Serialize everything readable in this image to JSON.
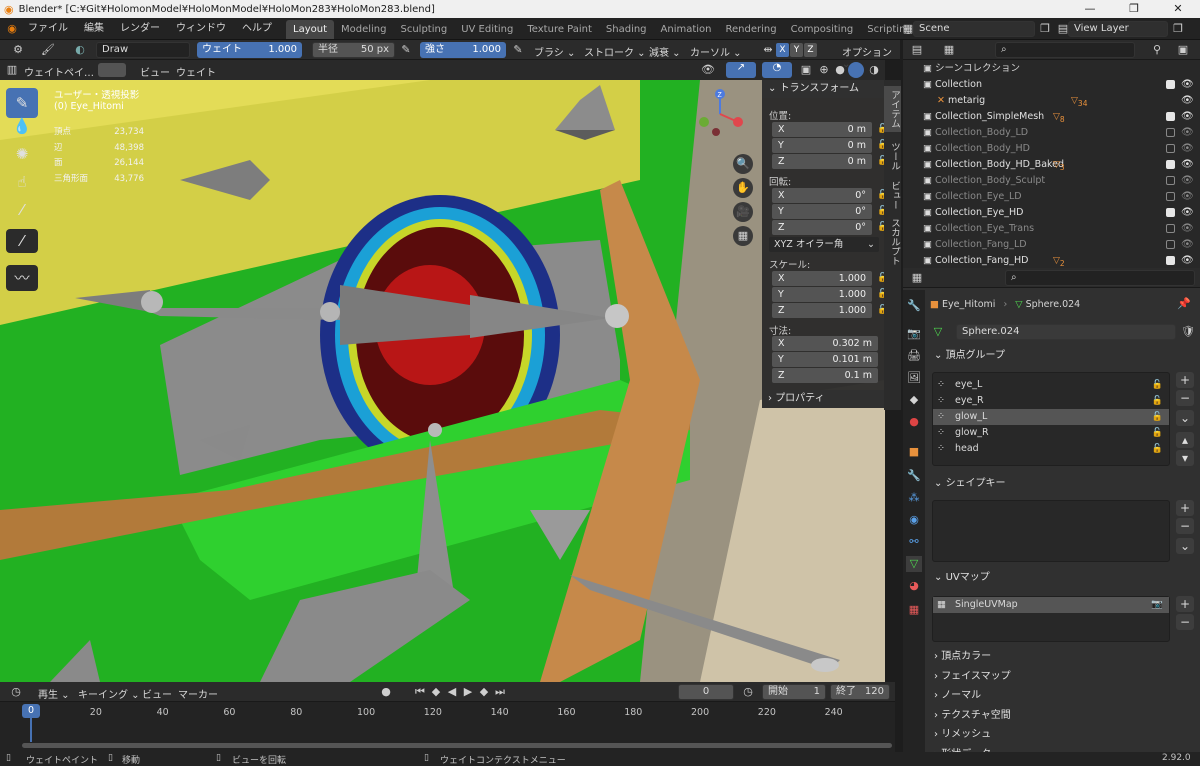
{
  "window": {
    "title": "Blender* [C:¥Git¥HolomonModel¥HoloMonModel¥HoloMon283¥HoloMon283.blend]"
  },
  "menu": [
    "ファイル",
    "編集",
    "レンダー",
    "ウィンドウ",
    "ヘルプ"
  ],
  "workspaces": [
    "Layout",
    "Modeling",
    "Sculpting",
    "UV Editing",
    "Texture Paint",
    "Shading",
    "Animation",
    "Rendering",
    "Compositing",
    "Scripting"
  ],
  "active_workspace": "Layout",
  "scene": {
    "name": "Scene",
    "view_layer": "View Layer"
  },
  "tool_header": {
    "brush": "Draw",
    "weight_label": "ウェイト",
    "weight": "1.000",
    "radius_label": "半径",
    "radius": "50 px",
    "strength_label": "強さ",
    "strength": "1.000",
    "brush_menu": "ブラシ",
    "stroke_menu": "ストローク",
    "falloff_menu": "減衰",
    "cursor_menu": "カーソル",
    "axes": [
      "X",
      "Y",
      "Z"
    ],
    "options_menu": "オプション"
  },
  "viewport_header": {
    "mode": "ウェイトペイ…",
    "view": "ビュー",
    "weights": "ウェイト"
  },
  "viewport_overlay": {
    "projection": "ユーザー・透視投影",
    "object": "(0) Eye_Hitomi",
    "stats": [
      {
        "label": "頂点",
        "value": "23,734"
      },
      {
        "label": "辺",
        "value": "48,398"
      },
      {
        "label": "面",
        "value": "26,144"
      },
      {
        "label": "三角形面",
        "value": "43,776"
      }
    ]
  },
  "n_panel": {
    "transform": "トランスフォーム",
    "location_label": "位置:",
    "location": [
      {
        "axis": "X",
        "value": "0 m"
      },
      {
        "axis": "Y",
        "value": "0 m"
      },
      {
        "axis": "Z",
        "value": "0 m"
      }
    ],
    "rotation_label": "回転:",
    "rotation": [
      {
        "axis": "X",
        "value": "0°"
      },
      {
        "axis": "Y",
        "value": "0°"
      },
      {
        "axis": "Z",
        "value": "0°"
      }
    ],
    "rotation_mode": "XYZ オイラー角",
    "scale_label": "スケール:",
    "scale": [
      {
        "axis": "X",
        "value": "1.000"
      },
      {
        "axis": "Y",
        "value": "1.000"
      },
      {
        "axis": "Z",
        "value": "1.000"
      }
    ],
    "dimensions_label": "寸法:",
    "dimensions": [
      {
        "axis": "X",
        "value": "0.302 m"
      },
      {
        "axis": "Y",
        "value": "0.101 m"
      },
      {
        "axis": "Z",
        "value": "0.1 m"
      }
    ],
    "properties": "プロパティ",
    "side_tabs": [
      "アイテム",
      "ツール",
      "ビュー",
      "スカルプト"
    ]
  },
  "outliner": {
    "root": "シーンコレクション",
    "rows": [
      {
        "name": "Collection",
        "checked": true,
        "dim": false,
        "indent": 1
      },
      {
        "name": "metarig",
        "checked": false,
        "dim": false,
        "indent": 2,
        "badge": "34"
      },
      {
        "name": "Collection_SimpleMesh",
        "checked": true,
        "dim": false,
        "indent": 1,
        "badge": "8"
      },
      {
        "name": "Collection_Body_LD",
        "checked": false,
        "dim": true,
        "indent": 1
      },
      {
        "name": "Collection_Body_HD",
        "checked": false,
        "dim": true,
        "indent": 1
      },
      {
        "name": "Collection_Body_HD_Baked",
        "checked": true,
        "dim": false,
        "indent": 1,
        "badge": "3"
      },
      {
        "name": "Collection_Body_Sculpt",
        "checked": false,
        "dim": true,
        "indent": 1
      },
      {
        "name": "Collection_Eye_LD",
        "checked": false,
        "dim": true,
        "indent": 1
      },
      {
        "name": "Collection_Eye_HD",
        "checked": true,
        "dim": false,
        "indent": 1
      },
      {
        "name": "Collection_Eye_Trans",
        "checked": false,
        "dim": true,
        "indent": 1
      },
      {
        "name": "Collection_Fang_LD",
        "checked": false,
        "dim": true,
        "indent": 1
      },
      {
        "name": "Collection_Fang_HD",
        "checked": true,
        "dim": false,
        "indent": 1,
        "badge": "2"
      }
    ]
  },
  "properties": {
    "object": "Eye_Hitomi",
    "mesh": "Sphere.024",
    "mesh_field": "Sphere.024",
    "vertex_groups_title": "頂点グループ",
    "vertex_groups": [
      "eye_L",
      "eye_R",
      "glow_L",
      "glow_R",
      "head"
    ],
    "selected_group": "glow_L",
    "shape_keys_title": "シェイプキー",
    "uv_maps_title": "UVマップ",
    "uv_maps": [
      "SingleUVMap"
    ],
    "collapsed_sections": [
      "頂点カラー",
      "フェイスマップ",
      "ノーマル",
      "テクスチャ空間",
      "リメッシュ",
      "形状データ"
    ]
  },
  "timeline": {
    "playback": "再生",
    "keying": "キーイング",
    "view": "ビュー",
    "marker": "マーカー",
    "current_frame": "0",
    "start_label": "開始",
    "start": "1",
    "end_label": "終了",
    "end": "120",
    "ruler": [
      "0",
      "20",
      "40",
      "60",
      "80",
      "100",
      "120",
      "140",
      "160",
      "180",
      "200",
      "220",
      "240"
    ]
  },
  "statusbar": {
    "left": "ウェイトペイント",
    "move": "移動",
    "rotate": "ビューを回転",
    "context": "ウェイトコンテクストメニュー",
    "version": "2.92.0"
  },
  "colors": {
    "accent": "#4772b3",
    "active_tab": "#464646",
    "header": "#2b2b2b",
    "panel": "#303030"
  }
}
